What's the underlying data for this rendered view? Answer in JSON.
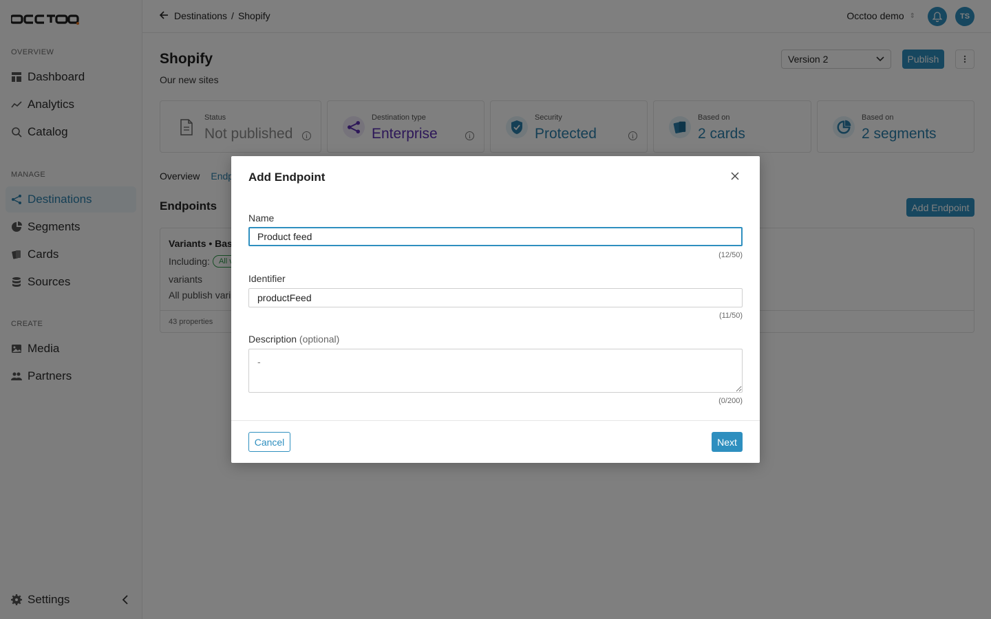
{
  "app": {
    "logo_text": "OCCTOO"
  },
  "sidebar": {
    "sections": {
      "overview": "OVERVIEW",
      "manage": "MANAGE",
      "create": "CREATE"
    },
    "items": [
      {
        "label": "Dashboard",
        "icon": "dashboard-icon"
      },
      {
        "label": "Analytics",
        "icon": "analytics-icon"
      },
      {
        "label": "Catalog",
        "icon": "search-icon"
      },
      {
        "label": "Destinations",
        "icon": "share-icon",
        "active": true
      },
      {
        "label": "Segments",
        "icon": "pie-icon"
      },
      {
        "label": "Cards",
        "icon": "cards-icon"
      },
      {
        "label": "Sources",
        "icon": "database-icon"
      },
      {
        "label": "Media",
        "icon": "image-icon"
      },
      {
        "label": "Partners",
        "icon": "users-icon"
      }
    ],
    "settings_label": "Settings"
  },
  "topbar": {
    "breadcrumb": [
      "Destinations",
      "Shopify"
    ],
    "org_name": "Occtoo demo",
    "avatar_initials": "TS"
  },
  "page": {
    "title": "Shopify",
    "subtitle": "Our new sites",
    "version_select": "Version 2",
    "publish_label": "Publish"
  },
  "cards": [
    {
      "label": "Status",
      "value": "Not published",
      "icon": "document-icon",
      "value_color": "#8a8a8a"
    },
    {
      "label": "Destination type",
      "value": "Enterprise",
      "icon": "share-icon",
      "value_color": "#5b2eb0"
    },
    {
      "label": "Security",
      "value": "Protected",
      "icon": "shield-icon",
      "value_color": "#2a7fab"
    },
    {
      "label": "Based on",
      "value": "2 cards",
      "icon": "cards-icon",
      "value_color": "#2a7fab"
    },
    {
      "label": "Based on",
      "value": "2 segments",
      "icon": "pie-icon",
      "value_color": "#2a7fab"
    }
  ],
  "tabs": [
    "Overview",
    "Endp"
  ],
  "endpoints": {
    "title": "Endpoints",
    "add_label": "Add Endpoint",
    "item": {
      "name": "Variants • Base",
      "including_label": "Including:",
      "pill": "All v",
      "line3": "variants",
      "line4": "All publish vari",
      "footer": "43 properties"
    }
  },
  "modal": {
    "title": "Add Endpoint",
    "name_label": "Name",
    "name_value": "Product feed",
    "name_counter": "(12/50)",
    "identifier_label": "Identifier",
    "identifier_value": "productFeed",
    "identifier_counter": "(11/50)",
    "description_label": "Description",
    "description_optional": "(optional)",
    "description_placeholder": "-",
    "description_counter": "(0/200)",
    "cancel_label": "Cancel",
    "next_label": "Next"
  },
  "colors": {
    "accent": "#2e8fbf",
    "active_nav": "#2a7fab",
    "enterprise": "#5b2eb0"
  }
}
